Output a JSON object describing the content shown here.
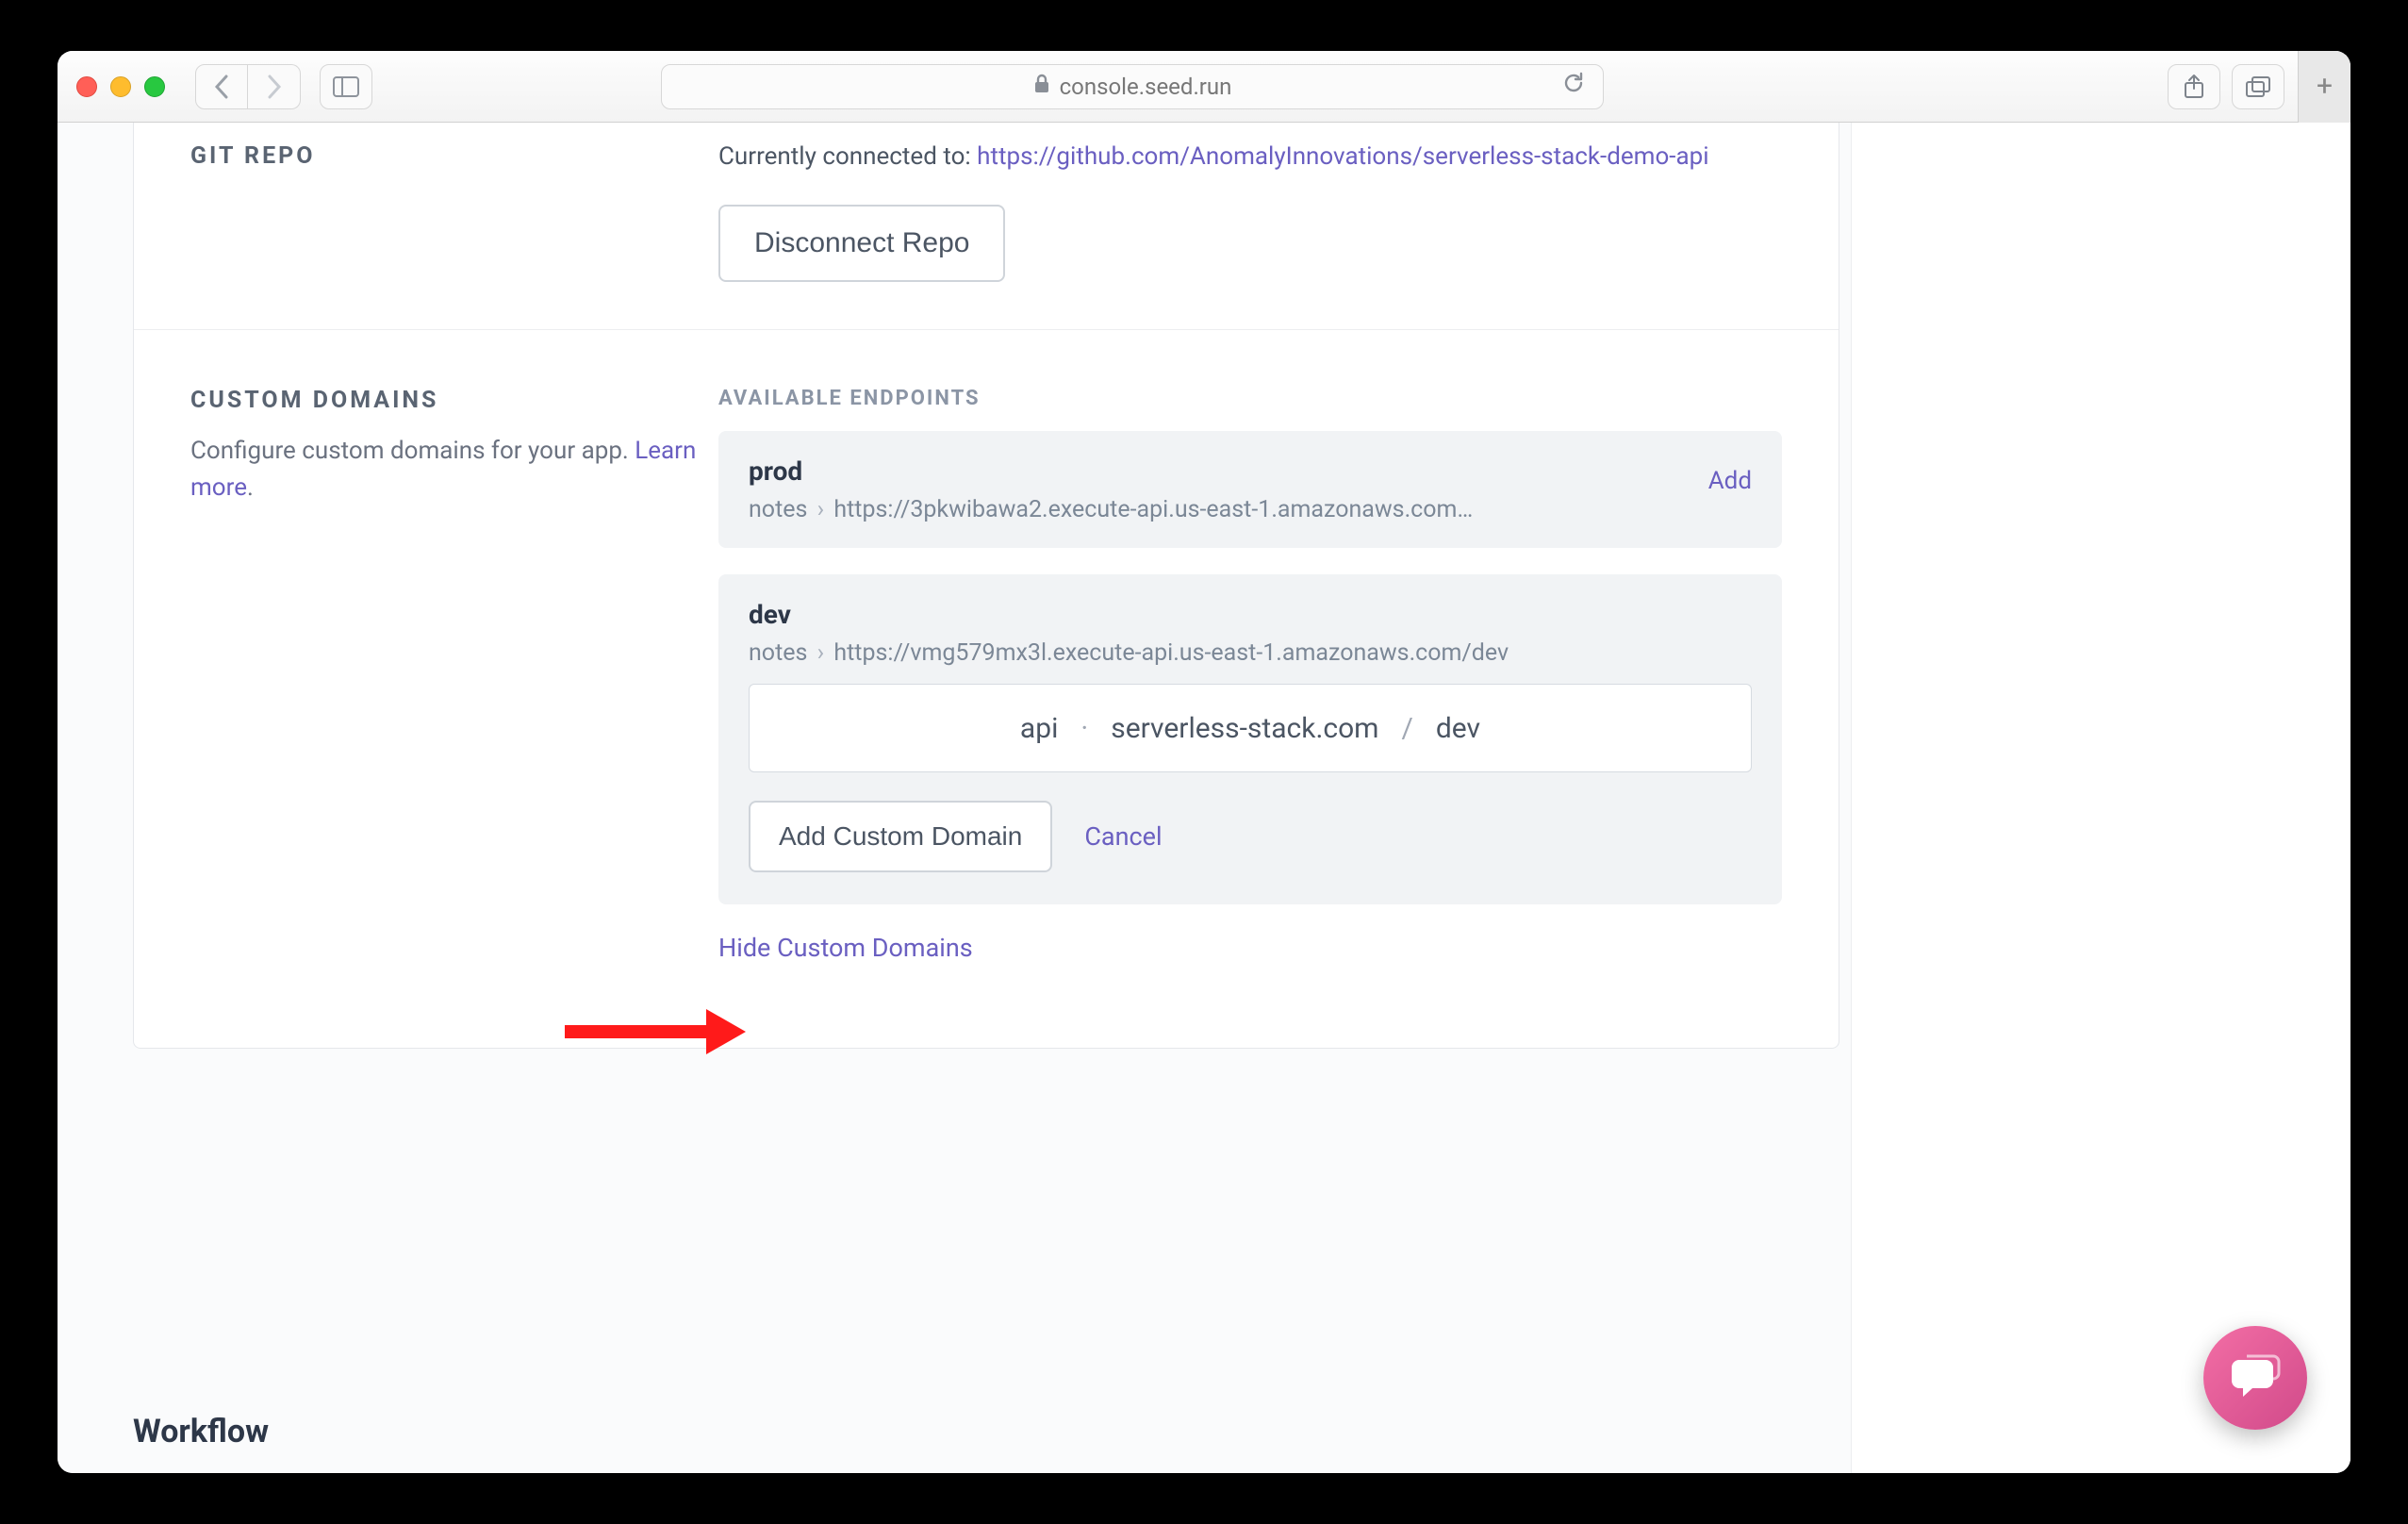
{
  "browser": {
    "url": "console.seed.run"
  },
  "git": {
    "heading": "GIT REPO",
    "connected_label": "Currently connected to: ",
    "repo_url": "https://github.com/AnomalyInnovations/serverless-stack-demo-api",
    "disconnect": "Disconnect Repo"
  },
  "domains": {
    "heading": "CUSTOM DOMAINS",
    "description_prefix": "Configure custom domains for your app. ",
    "learn_more": "Learn more",
    "available_heading": "AVAILABLE ENDPOINTS",
    "endpoints": [
      {
        "name": "prod",
        "service": "notes",
        "url": "https://3pkwibawa2.execute-api.us-east-1.amazonaws.com…",
        "action": "Add"
      },
      {
        "name": "dev",
        "service": "notes",
        "url": "https://vmg579mx3l.execute-api.us-east-1.amazonaws.com/dev"
      }
    ],
    "form": {
      "subdomain": "api",
      "domain": "serverless-stack.com",
      "path": "dev",
      "add_button": "Add Custom Domain",
      "cancel": "Cancel"
    },
    "hide_link": "Hide Custom Domains"
  },
  "workflow": {
    "heading": "Workflow"
  }
}
